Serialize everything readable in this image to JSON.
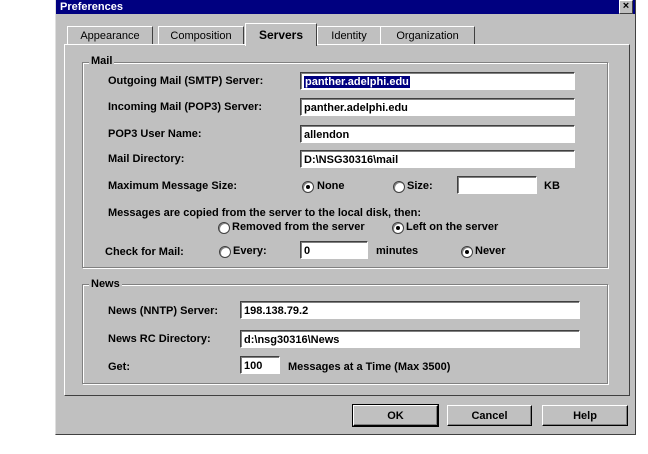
{
  "window": {
    "title": "Preferences",
    "close_glyph": "×"
  },
  "tabs": [
    {
      "label": "Appearance",
      "active": false
    },
    {
      "label": "Composition",
      "active": false
    },
    {
      "label": "Servers",
      "active": true
    },
    {
      "label": "Identity",
      "active": false
    },
    {
      "label": "Organization",
      "active": false
    }
  ],
  "mail": {
    "group_title": "Mail",
    "outgoing": {
      "label": "Outgoing Mail (SMTP) Server:",
      "value": "panther.adelphi.edu"
    },
    "incoming": {
      "label": "Incoming Mail (POP3) Server:",
      "value": "panther.adelphi.edu"
    },
    "user": {
      "label": "POP3 User Name:",
      "value": "allendon"
    },
    "directory": {
      "label": "Mail Directory:",
      "value": "D:\\NSG30316\\mail"
    },
    "max_size": {
      "label": "Maximum Message Size:",
      "none_label": "None",
      "size_label": "Size:",
      "size_value": "",
      "unit": "KB",
      "selected": "None"
    },
    "copy_text": "Messages are copied from the server to the local disk, then:",
    "removed_label": "Removed from the server",
    "left_label": "Left on the server",
    "copy_selected": "Left on the server",
    "check": {
      "label": "Check for Mail:",
      "every_label": "Every:",
      "minutes_value": "0",
      "minutes_label": "minutes",
      "never_label": "Never",
      "selected": "Never"
    }
  },
  "news": {
    "group_title": "News",
    "server": {
      "label": "News (NNTP) Server:",
      "value": "198.138.79.2"
    },
    "rc_dir": {
      "label": "News RC Directory:",
      "value": "d:\\nsg30316\\News"
    },
    "get": {
      "label": "Get:",
      "value": "100",
      "suffix": "Messages at a Time (Max 3500)"
    }
  },
  "buttons": {
    "ok": "OK",
    "cancel": "Cancel",
    "help": "Help"
  }
}
